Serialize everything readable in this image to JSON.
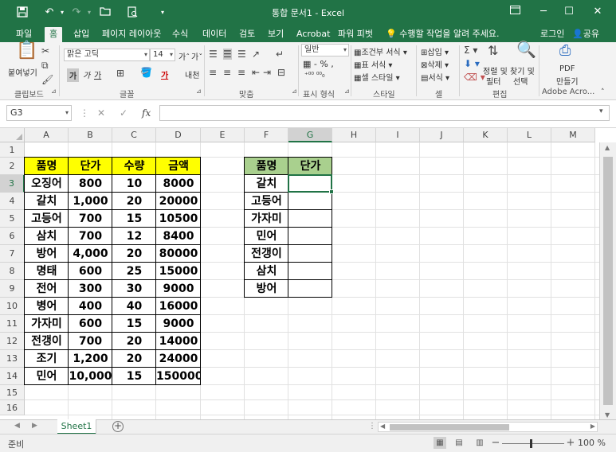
{
  "window": {
    "title": "통합 문서1 - Excel",
    "colors": {
      "excel_green": "#217346",
      "header_yellow": "#ffff00",
      "header_green": "#a9d08e"
    }
  },
  "qat": [
    "save-icon",
    "undo-icon",
    "redo-icon",
    "open-icon",
    "print-preview-icon",
    "customize-icon"
  ],
  "tabs": [
    "파일",
    "홈",
    "삽입",
    "페이지 레이아웃",
    "수식",
    "데이터",
    "검토",
    "보기",
    "Acrobat",
    "파워 피벗"
  ],
  "tell_me": "수행할 작업을 알려 주세요.",
  "login": "로그인",
  "share": "공유",
  "ribbon": {
    "clipboard": {
      "paste": "붙여넣기",
      "label": "클립보드"
    },
    "font": {
      "name": "맑은 고딕",
      "size": "14",
      "bold": "가",
      "italic": "가",
      "underline": "가",
      "phonetic": "내천",
      "label": "글꼴"
    },
    "align": {
      "label": "맞춤"
    },
    "number": {
      "format": "일반",
      "label": "표시 형식"
    },
    "styles": {
      "cond": "조건부 서식",
      "table": "표 서식",
      "cell": "셀 스타일",
      "label": "스타일"
    },
    "cells": {
      "insert": "삽입",
      "delete": "삭제",
      "format": "서식",
      "label": "셀"
    },
    "editing": {
      "sort1": "정렬 및",
      "sort2": "필터",
      "find1": "찾기 및",
      "find2": "선택",
      "label": "편집"
    },
    "acrobat": {
      "pdf1": "PDF",
      "pdf2": "만들기",
      "label": "Adobe Acro..."
    }
  },
  "formula_bar": {
    "name_box": "G3",
    "fx": "fx",
    "value": ""
  },
  "columns": [
    "A",
    "B",
    "C",
    "D",
    "E",
    "F",
    "G",
    "H",
    "I",
    "J",
    "K",
    "L",
    "M"
  ],
  "rows": [
    "1",
    "2",
    "3",
    "4",
    "5",
    "6",
    "7",
    "8",
    "9",
    "10",
    "11",
    "12",
    "13",
    "14",
    "15",
    "16"
  ],
  "table1": {
    "headers": [
      "품명",
      "단가",
      "수량",
      "금액"
    ],
    "rows": [
      [
        "오징어",
        "800",
        "10",
        "8000"
      ],
      [
        "갈치",
        "1,000",
        "20",
        "20000"
      ],
      [
        "고등어",
        "700",
        "15",
        "10500"
      ],
      [
        "삼치",
        "700",
        "12",
        "8400"
      ],
      [
        "방어",
        "4,000",
        "20",
        "80000"
      ],
      [
        "명태",
        "600",
        "25",
        "15000"
      ],
      [
        "전어",
        "300",
        "30",
        "9000"
      ],
      [
        "병어",
        "400",
        "40",
        "16000"
      ],
      [
        "가자미",
        "600",
        "15",
        "9000"
      ],
      [
        "전갱이",
        "700",
        "20",
        "14000"
      ],
      [
        "조기",
        "1,200",
        "20",
        "24000"
      ],
      [
        "민어",
        "10,000",
        "15",
        "150000"
      ]
    ]
  },
  "table2": {
    "headers": [
      "품명",
      "단가"
    ],
    "rows": [
      [
        "갈치",
        ""
      ],
      [
        "고등어",
        ""
      ],
      [
        "가자미",
        ""
      ],
      [
        "민어",
        ""
      ],
      [
        "전갱이",
        ""
      ],
      [
        "삼치",
        ""
      ],
      [
        "방어",
        ""
      ]
    ]
  },
  "sheet": {
    "name": "Sheet1"
  },
  "status": {
    "ready": "준비",
    "zoom": "100 %"
  }
}
